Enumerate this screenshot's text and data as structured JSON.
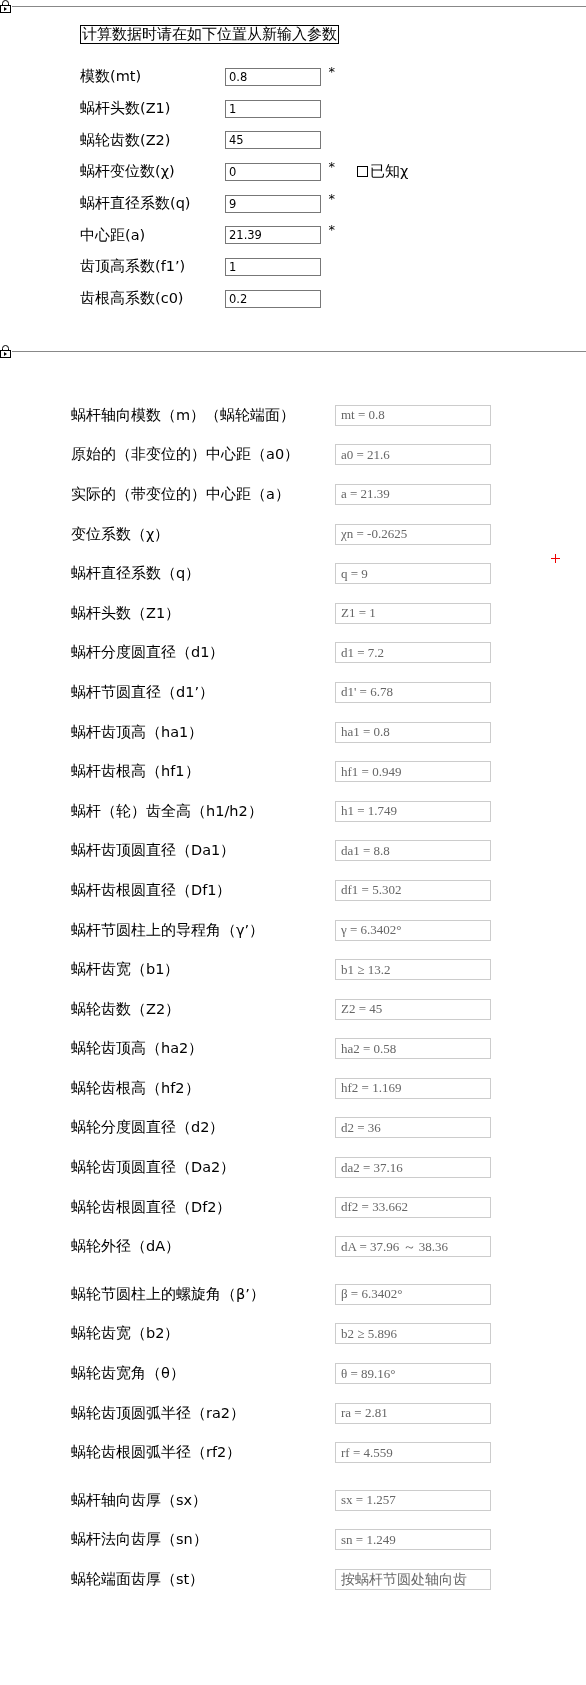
{
  "params": {
    "title": "计算数据时请在如下位置从新输入参数",
    "fields": [
      {
        "label": "模数(mt)",
        "value": "0.8",
        "mark": "*"
      },
      {
        "label": "蜗杆头数(Z1)",
        "value": "1"
      },
      {
        "label": "蜗轮齿数(Z2)",
        "value": "45"
      },
      {
        "label": "蜗杆变位数(χ)",
        "value": "0",
        "mark": "*",
        "checkbox": {
          "label": "已知χ",
          "checked": false
        }
      },
      {
        "label": "蜗杆直径系数(q)",
        "value": "9",
        "mark": "*"
      },
      {
        "label": "中心距(a)",
        "value": "21.39",
        "mark": "*"
      },
      {
        "label": "齿顶高系数(f1’)",
        "value": "1"
      },
      {
        "label": "齿根高系数(c0)",
        "value": "0.2"
      }
    ]
  },
  "results": {
    "groups": [
      [
        {
          "label": "蜗杆轴向模数（m）（蜗轮端面）",
          "value": "mt = 0.8",
          "kind": "formula"
        },
        {
          "label": "原始的（非变位的）中心距（a0）",
          "value": "a0 = 21.6",
          "kind": "formula"
        },
        {
          "label": "实际的（带变位的）中心距（a）",
          "value": "a = 21.39",
          "kind": "formula"
        },
        {
          "label": "变位系数（χ）",
          "value": "χn = -0.2625",
          "kind": "formula"
        },
        {
          "label": "蜗杆直径系数（q）",
          "value": "q = 9",
          "kind": "formula"
        },
        {
          "label": "蜗杆头数（Z1）",
          "value": "Z1 = 1",
          "kind": "formula"
        },
        {
          "label": "蜗杆分度圆直径（d1）",
          "value": "d1 = 7.2",
          "kind": "formula"
        },
        {
          "label": "蜗杆节圆直径（d1’）",
          "value": "d1' = 6.78",
          "kind": "formula"
        },
        {
          "label": "蜗杆齿顶高（ha1）",
          "value": "ha1 = 0.8",
          "kind": "formula"
        },
        {
          "label": "蜗杆齿根高（hf1）",
          "value": "hf1 = 0.949",
          "kind": "formula"
        },
        {
          "label": "蜗杆（轮）齿全高（h1/h2）",
          "value": "h1 = 1.749",
          "kind": "formula"
        },
        {
          "label": "蜗杆齿顶圆直径（Da1）",
          "value": "da1 = 8.8",
          "kind": "formula"
        },
        {
          "label": "蜗杆齿根圆直径（Df1）",
          "value": "df1 = 5.302",
          "kind": "formula"
        },
        {
          "label": "蜗杆节圆柱上的导程角（γ’）",
          "value": "γ = 6.3402°",
          "kind": "formula"
        },
        {
          "label": "蜗杆齿宽（b1）",
          "value": "b1 ≥ 13.2",
          "kind": "formula"
        },
        {
          "label": "蜗轮齿数（Z2）",
          "value": "Z2 = 45",
          "kind": "formula"
        },
        {
          "label": "蜗轮齿顶高（ha2）",
          "value": "ha2 = 0.58",
          "kind": "formula"
        },
        {
          "label": "蜗轮齿根高（hf2）",
          "value": "hf2 = 1.169",
          "kind": "formula"
        },
        {
          "label": "蜗轮分度圆直径（d2）",
          "value": "d2 = 36",
          "kind": "formula"
        },
        {
          "label": "蜗轮齿顶圆直径（Da2）",
          "value": "da2 = 37.16",
          "kind": "formula"
        },
        {
          "label": "蜗轮齿根圆直径（Df2）",
          "value": "df2 = 33.662",
          "kind": "formula"
        },
        {
          "label": "蜗轮外径（dA）",
          "value": "dA = 37.96 ～ 38.36",
          "kind": "formula"
        }
      ],
      [
        {
          "label": "蜗轮节圆柱上的螺旋角（β’）",
          "value": "β = 6.3402°",
          "kind": "formula"
        },
        {
          "label": "蜗轮齿宽（b2）",
          "value": "b2 ≥ 5.896",
          "kind": "formula"
        },
        {
          "label": "蜗轮齿宽角（θ）",
          "value": "θ = 89.16°",
          "kind": "formula"
        },
        {
          "label": "蜗轮齿顶圆弧半径（ra2）",
          "value": "ra = 2.81",
          "kind": "formula"
        },
        {
          "label": "蜗轮齿根圆弧半径（rf2）",
          "value": "rf = 4.559",
          "kind": "formula"
        }
      ],
      [
        {
          "label": "蜗杆轴向齿厚（sx）",
          "value": "sx = 1.257",
          "kind": "formula"
        },
        {
          "label": "蜗杆法向齿厚（sn）",
          "value": "sn = 1.249",
          "kind": "formula"
        },
        {
          "label": "蜗轮端面齿厚（st）",
          "value": "按蜗杆节圆处轴向齿",
          "kind": "note"
        }
      ]
    ]
  }
}
